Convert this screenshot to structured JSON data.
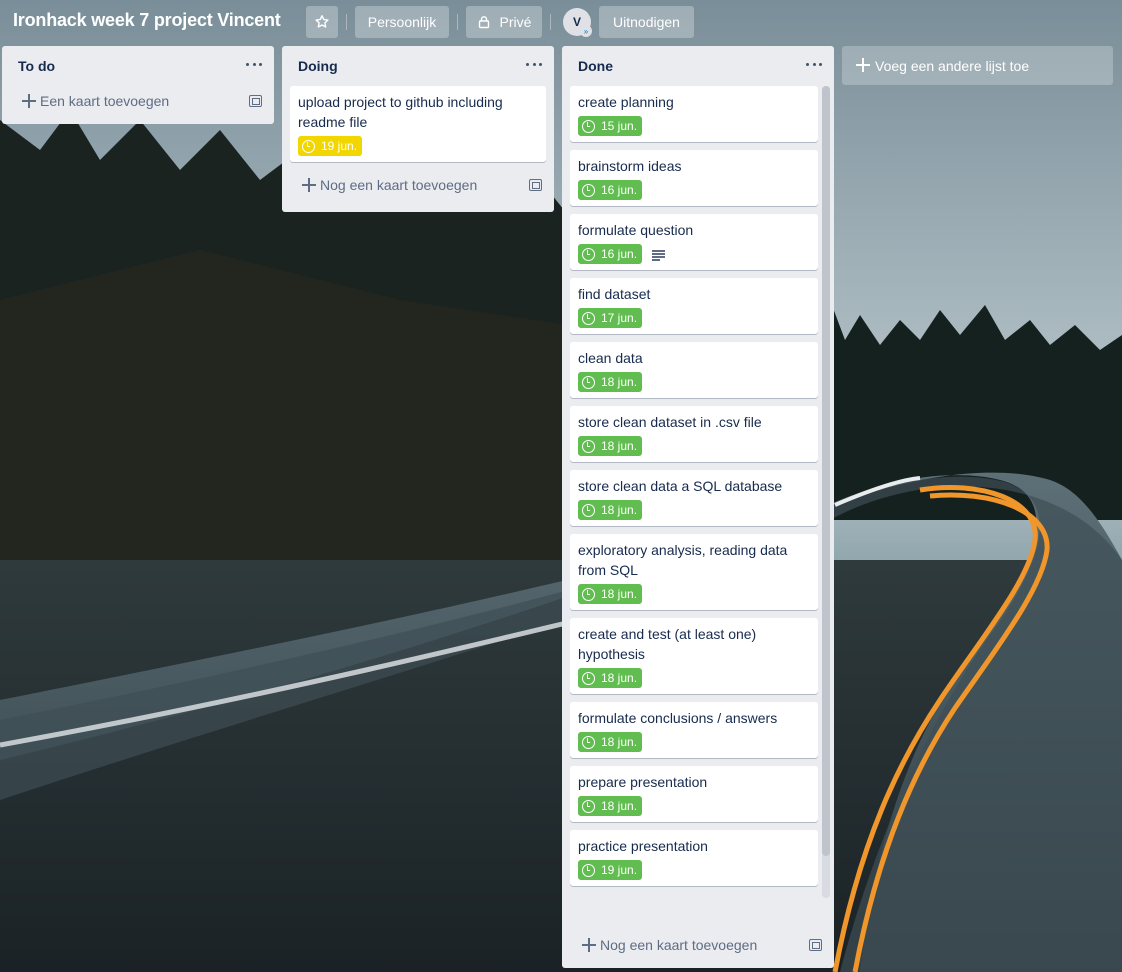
{
  "board": {
    "title": "Ironhack week 7 project Vincent",
    "star_icon": "star-icon",
    "workspace_label": "Persoonlijk",
    "visibility_label": "Privé",
    "avatar_initial": "V",
    "invite_label": "Uitnodigen"
  },
  "colors": {
    "due_complete": "#61bd4f",
    "due_soon": "#f2d600",
    "list_bg": "#ebecf0",
    "card_bg": "#ffffff"
  },
  "lists": [
    {
      "title": "To do",
      "add_label": "Een kaart toevoegen",
      "cards": []
    },
    {
      "title": "Doing",
      "add_label": "Nog een kaart toevoegen",
      "cards": [
        {
          "title": "upload project to github including readme file",
          "due": "19 jun.",
          "status": "soon"
        }
      ]
    },
    {
      "title": "Done",
      "add_label": "Nog een kaart toevoegen",
      "cards": [
        {
          "title": "create planning",
          "due": "15 jun.",
          "status": "complete"
        },
        {
          "title": "brainstorm ideas",
          "due": "16 jun.",
          "status": "complete"
        },
        {
          "title": "formulate question",
          "due": "16 jun.",
          "status": "complete",
          "has_description": true
        },
        {
          "title": "find dataset",
          "due": "17 jun.",
          "status": "complete"
        },
        {
          "title": "clean data",
          "due": "18 jun.",
          "status": "complete"
        },
        {
          "title": "store clean dataset in .csv file",
          "due": "18 jun.",
          "status": "complete"
        },
        {
          "title": "store clean data a SQL database",
          "due": "18 jun.",
          "status": "complete"
        },
        {
          "title": "exploratory analysis, reading data from SQL",
          "due": "18 jun.",
          "status": "complete"
        },
        {
          "title": "create and test (at least one) hypothesis",
          "due": "18 jun.",
          "status": "complete"
        },
        {
          "title": "formulate conclusions / answers",
          "due": "18 jun.",
          "status": "complete"
        },
        {
          "title": "prepare presentation",
          "due": "18 jun.",
          "status": "complete"
        },
        {
          "title": "practice presentation",
          "due": "19 jun.",
          "status": "complete"
        }
      ]
    }
  ],
  "add_list_label": "Voeg een andere lijst toe"
}
